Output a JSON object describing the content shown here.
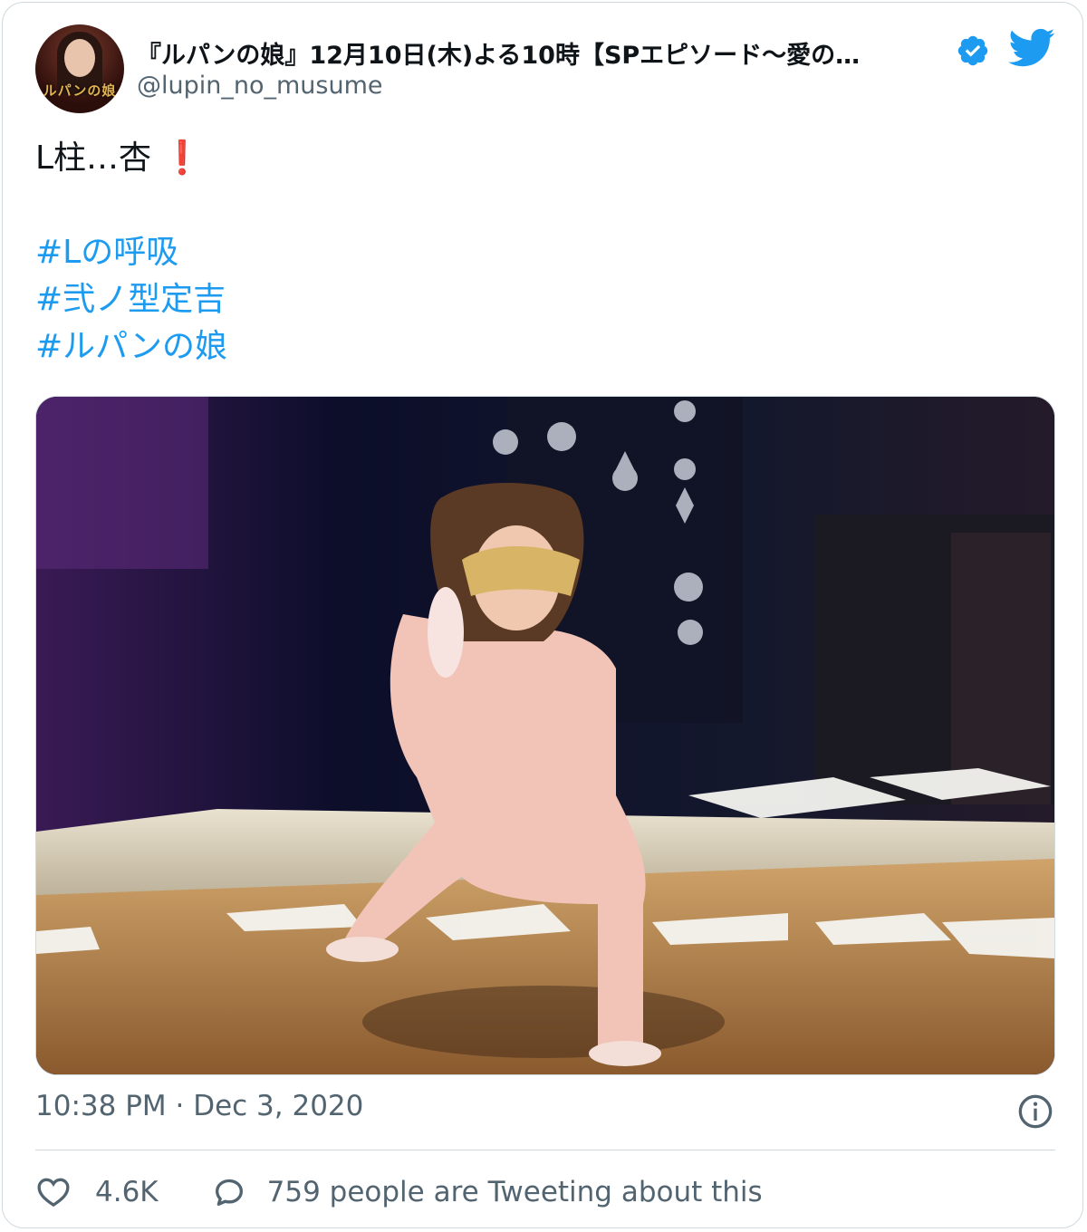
{
  "tweet": {
    "display_name": "『ルパンの娘』12月10日(木)よる10時【SPエピソード〜愛の…",
    "handle": "@lupin_no_musume",
    "avatar_logo_text": "ルパンの娘",
    "body_first": "L柱…杏",
    "body_emoji": "❗",
    "hashtags": [
      "#Lの呼吸",
      "#弐ノ型定吉",
      "#ルパンの娘"
    ],
    "timestamp": "10:38 PM · Dec 3, 2020",
    "likes": "4.6K",
    "people_tweeting": "759 people are Tweeting about this"
  },
  "icons": {
    "verified": "verified-badge-icon",
    "brand": "twitter-bird-icon",
    "info": "info-icon",
    "like": "heart-icon",
    "reply": "speech-bubble-icon"
  },
  "colors": {
    "link": "#1d9bf0",
    "muted": "#536471",
    "text": "#0f1419",
    "border": "#cfd9de",
    "emoji": "#e0245e"
  }
}
